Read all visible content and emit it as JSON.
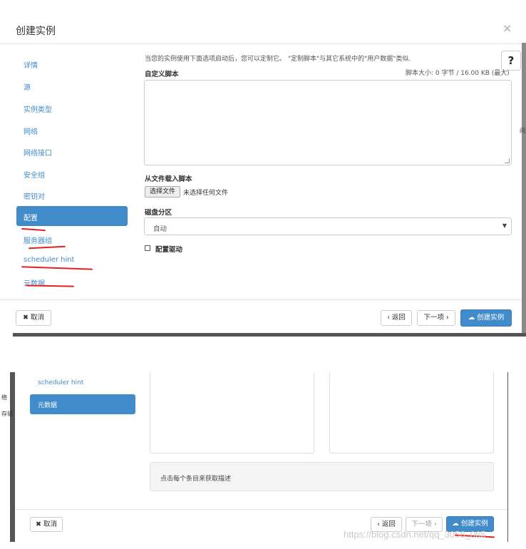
{
  "modal1": {
    "title": "创建实例",
    "close_glyph": "×",
    "sidebar": {
      "items": [
        "详情",
        "源",
        "实例类型",
        "网络",
        "网络接口",
        "安全组",
        "密钥对"
      ],
      "active": "配置",
      "after_items": [
        "服务器组",
        "scheduler hint",
        "元数据"
      ]
    },
    "help_glyph": "?",
    "description": "当您的实例使用下面选项启动后，您可以定制它。 \"定制脚本\"与其它系统中的\"用户数据\"类似.",
    "custom_script_label": "自定义脚本",
    "script_size": "脚本大小: 0 字节 / 16.00 KB (最大)",
    "load_from_file_label": "从文件载入脚本",
    "choose_file_button": "选择文件",
    "no_file_text": "未选择任何文件",
    "disk_partition_label": "磁盘分区",
    "disk_partition_value": "自动",
    "config_drive_label": "配置驱动",
    "footer": {
      "cancel": "✖ 取消",
      "back": "‹ 返回",
      "next": "下一项 ›",
      "create": "创建实例"
    },
    "edge_fragment": "问"
  },
  "modal2": {
    "sidebar_items": [
      "scheduler hint"
    ],
    "active": "元数据",
    "info_text": "点击每个条目来获取描述",
    "footer": {
      "cancel": "✖ 取消",
      "back": "‹ 返回",
      "next": "下一项 ›",
      "create": "创建实例"
    },
    "edge_fragments": [
      "络",
      "存储"
    ]
  },
  "watermark": "https://blog.csdn.net/qq_3056_065",
  "colors": {
    "accent": "#428bca",
    "annotation_red": "#e32222"
  },
  "icons": {
    "cancel": "times-icon",
    "create": "cloud-upload-icon",
    "help": "question-circle-icon",
    "select": "caret-down-icon"
  }
}
